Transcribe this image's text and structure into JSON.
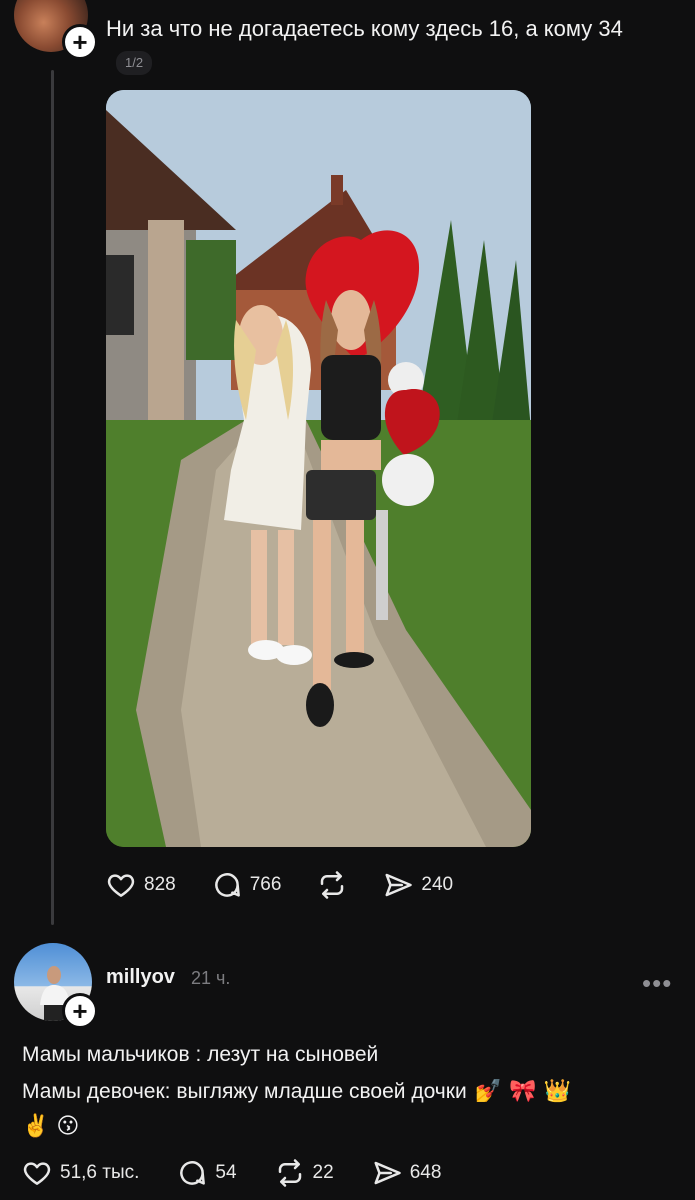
{
  "top_post": {
    "text": "Ни за что не догадаетесь кому здесь 16, а кому 34",
    "page_indicator": "1/2",
    "likes": "828",
    "comments": "766",
    "shares": "240"
  },
  "second_post": {
    "username": "millyov",
    "time": "21 ч.",
    "line1": "Мамы мальчиков : лезут на сыновей",
    "line2": "Мамы девочек: выгляжу младше своей дочки",
    "line2_emojis": "💅 🎀 👑",
    "line3_emojis": "✌️ 😗",
    "likes": "51,6 тыс.",
    "comments": "54",
    "reposts": "22",
    "shares": "648"
  },
  "colors": {
    "background": "#0f0f10",
    "text": "#f2f2f2",
    "muted": "#7c7c80",
    "thread_line": "#3a3a3d",
    "balloon_red": "#d4161f"
  },
  "icons": [
    "plus-icon",
    "heart-icon",
    "comment-icon",
    "repost-icon",
    "share-icon",
    "more-icon"
  ]
}
